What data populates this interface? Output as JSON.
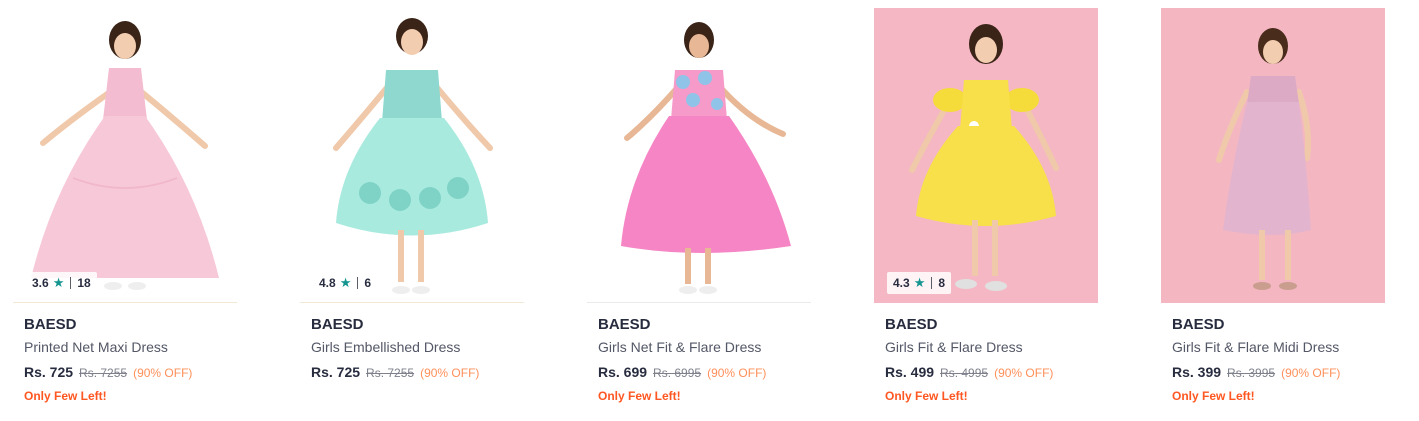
{
  "products": [
    {
      "brand": "BAESD",
      "title": "Printed Net Maxi Dress",
      "price": "Rs. 725",
      "mrp": "Rs. 7255",
      "discount": "(90% OFF)",
      "stock": "Only Few Left!",
      "rating": "3.6",
      "rating_count": "18",
      "bg": "#ffffff",
      "dress_color": "#f7c9d8"
    },
    {
      "brand": "BAESD",
      "title": "Girls Embellished Dress",
      "price": "Rs. 725",
      "mrp": "Rs. 7255",
      "discount": "(90% OFF)",
      "stock": "",
      "rating": "4.8",
      "rating_count": "6",
      "bg": "#ffffff",
      "dress_color": "#a9eadf"
    },
    {
      "brand": "BAESD",
      "title": "Girls Net Fit & Flare Dress",
      "price": "Rs. 699",
      "mrp": "Rs. 6995",
      "discount": "(90% OFF)",
      "stock": "Only Few Left!",
      "bg": "#ffffff",
      "dress_color": "#f585c4"
    },
    {
      "brand": "BAESD",
      "title": "Girls Fit & Flare Dress",
      "price": "Rs. 499",
      "mrp": "Rs. 4995",
      "discount": "(90% OFF)",
      "stock": "Only Few Left!",
      "rating": "4.3",
      "rating_count": "8",
      "bg": "#f5b7c3",
      "dress_color": "#f7e04a"
    },
    {
      "brand": "BAESD",
      "title": "Girls Fit & Flare Midi Dress",
      "price": "Rs. 399",
      "mrp": "Rs. 3995",
      "discount": "(90% OFF)",
      "stock": "Only Few Left!",
      "bg": "#f4b7c2",
      "dress_color": "#e3b4cd"
    }
  ],
  "star_icon": "star-icon"
}
